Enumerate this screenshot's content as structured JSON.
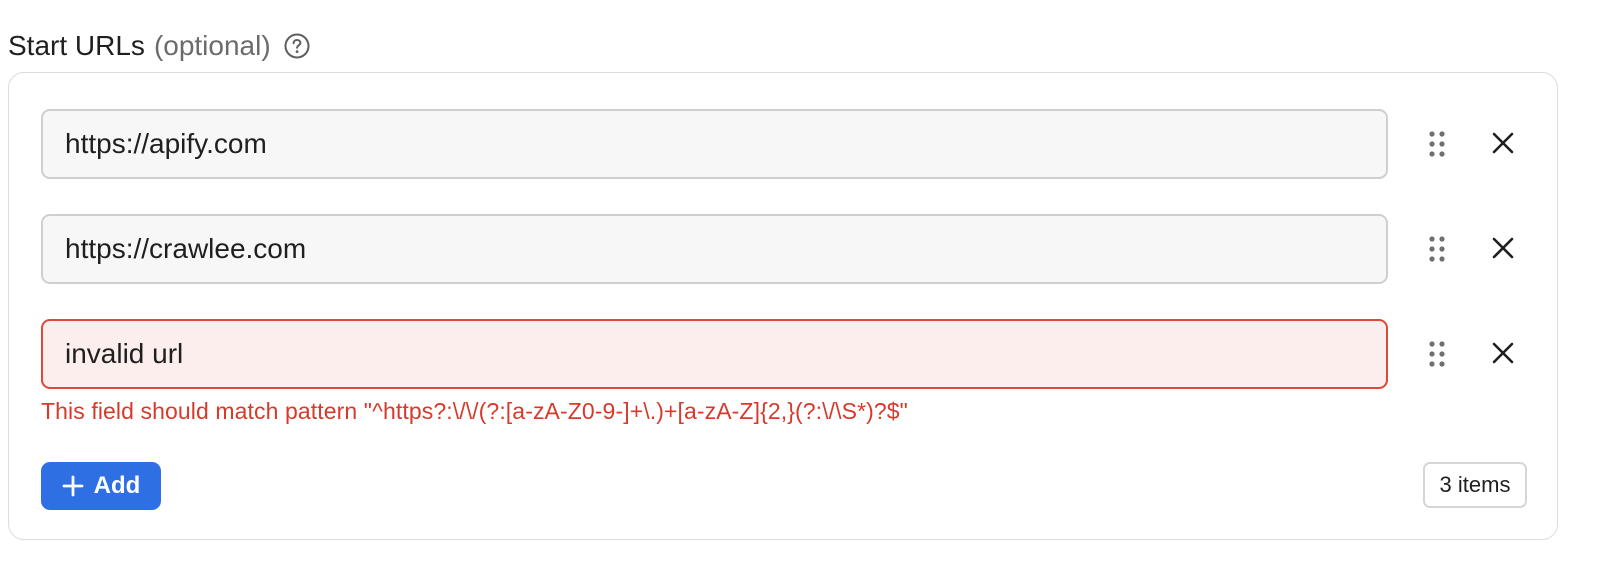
{
  "field": {
    "title": "Start URLs",
    "optional": "(optional)",
    "help_icon": "question-circle-icon"
  },
  "urls": [
    {
      "value": "https://apify.com",
      "invalid": false
    },
    {
      "value": "https://crawlee.com",
      "invalid": false
    },
    {
      "value": "invalid url",
      "invalid": true
    }
  ],
  "error_message": "This field should match pattern \"^https?:\\/\\/(?:[a-zA-Z0-9-]+\\.)+[a-zA-Z]{2,}(?:\\/\\S*)?$\"",
  "add_button": {
    "label": "Add",
    "icon": "plus-icon"
  },
  "item_count": "3 items",
  "icons": {
    "drag": "drag-handle-icon",
    "remove": "close-icon"
  },
  "colors": {
    "accent": "#2f6fe4",
    "error": "#d9392b",
    "error_bg": "#fbeeec",
    "input_bg": "#f7f7f7"
  }
}
